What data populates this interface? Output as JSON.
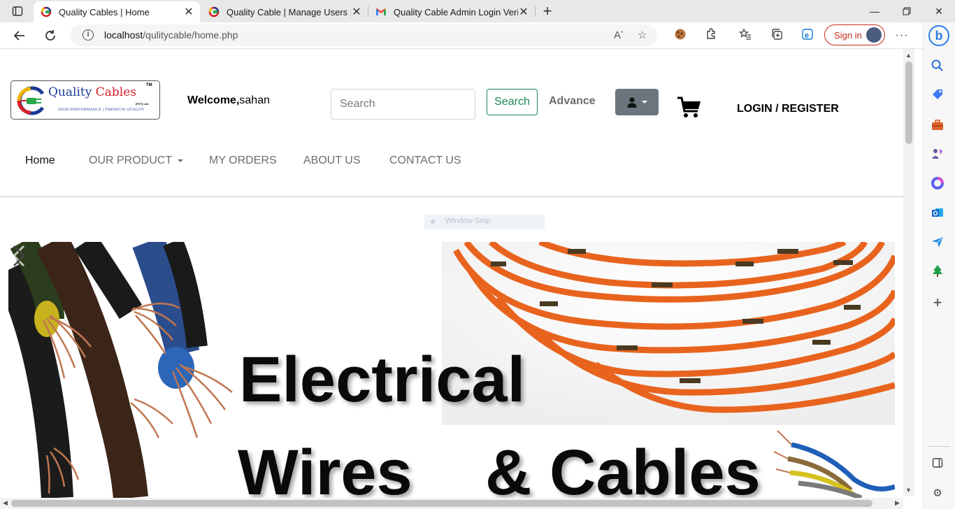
{
  "browser": {
    "tabs": [
      {
        "title": "Quality Cables | Home",
        "active": true
      },
      {
        "title": "Quality Cable | Manage Users | A",
        "active": false
      },
      {
        "title": "Quality Cable Admin Login Verific",
        "active": false
      }
    ],
    "address": {
      "host": "localhost",
      "path": "/qulitycable/home.php"
    },
    "sign_in_label": "Sign in",
    "colors": {
      "signin": "#c42b1c",
      "bing": "#2a7ee8"
    }
  },
  "site": {
    "logo": {
      "word1": "Quality",
      "word2": "Cables",
      "tm": "TM",
      "pvt": "(PVT) Ltd.",
      "tagline": "HIGH PERFORMANCE | PREMIUM QUALITY"
    },
    "welcome": {
      "label": "Welcome,",
      "user": "sahan"
    },
    "search": {
      "placeholder": "Search",
      "button": "Search"
    },
    "advance": "Advance",
    "login_register": "LOGIN / REGISTER",
    "nav": {
      "home": "Home",
      "product": "OUR PRODUCT",
      "orders": "MY ORDERS",
      "about": "ABOUT US",
      "contact": "CONTACT US"
    },
    "overlay": "Window Snip",
    "carousel": {
      "line1": "Electrical",
      "line2": "Wires",
      "line3": "& Cables"
    },
    "colors": {
      "search_btn": "#198754",
      "user_btn": "#6c757d",
      "cable_orange": "#e8641e"
    }
  }
}
